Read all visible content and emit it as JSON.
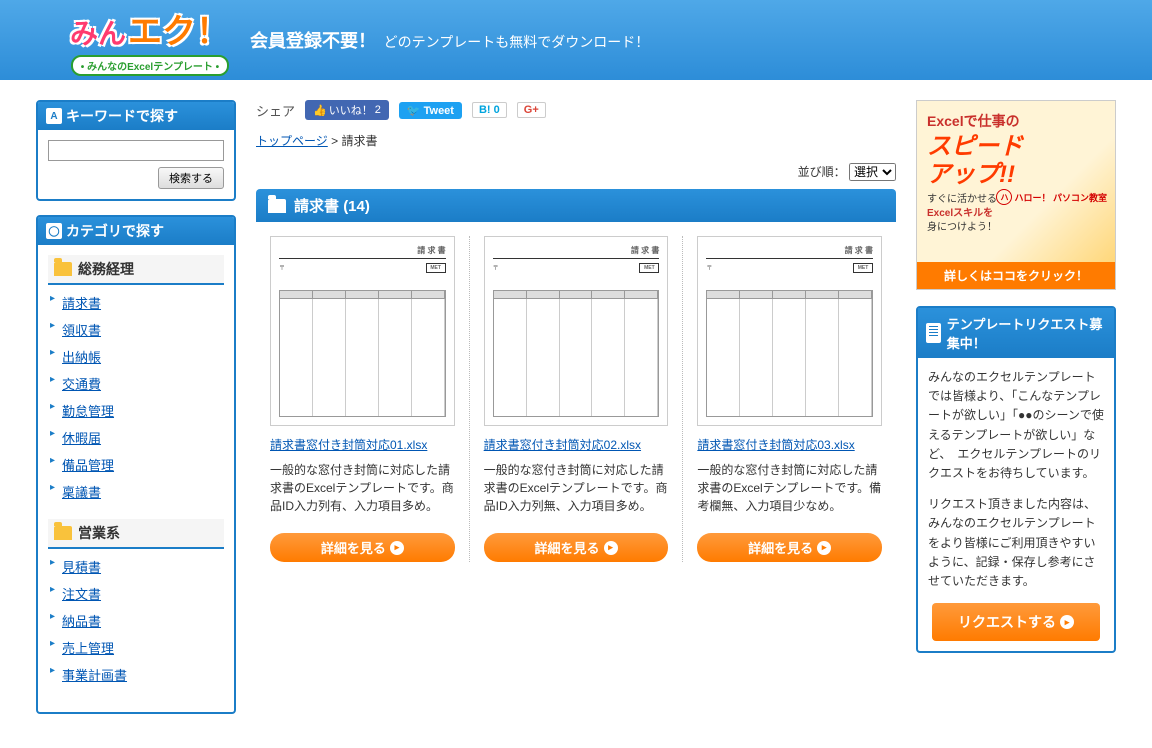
{
  "header": {
    "logo_left": "みん",
    "logo_right": "エク！",
    "logo_sub": "• みんなのExcelテンプレート •",
    "tagline_main": "会員登録不要！",
    "tagline_sub": "どのテンプレートも無料でダウンロード！"
  },
  "sidebar": {
    "keyword_head": "キーワードで探す",
    "search_btn": "検索する",
    "category_head": "カテゴリで探す",
    "groups": [
      {
        "title": "総務経理",
        "items": [
          "請求書",
          "領収書",
          "出納帳",
          "交通費",
          "勤怠管理",
          "休暇届",
          "備品管理",
          "稟議書"
        ]
      },
      {
        "title": "営業系",
        "items": [
          "見積書",
          "注文書",
          "納品書",
          "売上管理",
          "事業計画書"
        ]
      }
    ]
  },
  "share": {
    "label": "シェア",
    "fb": "いいね！",
    "fb_count": "2",
    "tweet": "Tweet",
    "hatena": "B!",
    "hatena_count": "0",
    "gplus": "G+"
  },
  "breadcrumb": {
    "top": "トップページ",
    "sep": " > ",
    "current": "請求書"
  },
  "sort": {
    "label": "並び順：",
    "value": "選択"
  },
  "section": {
    "title": "請求書",
    "count": "(14)"
  },
  "cards": [
    {
      "link": "請求書窓付き封筒対応01.xlsx",
      "desc": "一般的な窓付き封筒に対応した請求書のExcelテンプレートです。商品ID入力列有、入力項目多め。",
      "btn": "詳細を見る"
    },
    {
      "link": "請求書窓付き封筒対応02.xlsx",
      "desc": "一般的な窓付き封筒に対応した請求書のExcelテンプレートです。商品ID入力列無、入力項目多め。",
      "btn": "詳細を見る"
    },
    {
      "link": "請求書窓付き封筒対応03.xlsx",
      "desc": "一般的な窓付き封筒に対応した請求書のExcelテンプレートです。備考欄無、入力項目少なめ。",
      "btn": "詳細を見る"
    }
  ],
  "ad": {
    "l1": "Excelで仕事の",
    "l2a": "スピード",
    "l2b": "アップ!!",
    "l3a": "すぐに活かせる",
    "l3b": "Excelスキルを",
    "l3c": "身につけよう！",
    "brand": "ハロー！\nパソコン教室",
    "cta": "詳しくはココをクリック！"
  },
  "request": {
    "head": "テンプレートリクエスト募集中！",
    "body1": "みんなのエクセルテンプレートでは皆様より、「こんなテンプレートが欲しい」「●●のシーンで使えるテンプレートが欲しい」など、　エクセルテンプレートのリクエストをお待ちしています。",
    "body2": "リクエスト頂きました内容は、みんなのエクセルテンプレートをより皆様にご利用頂きやすいように、記録・保存し参考にさせていただきます。",
    "btn": "リクエストする"
  }
}
